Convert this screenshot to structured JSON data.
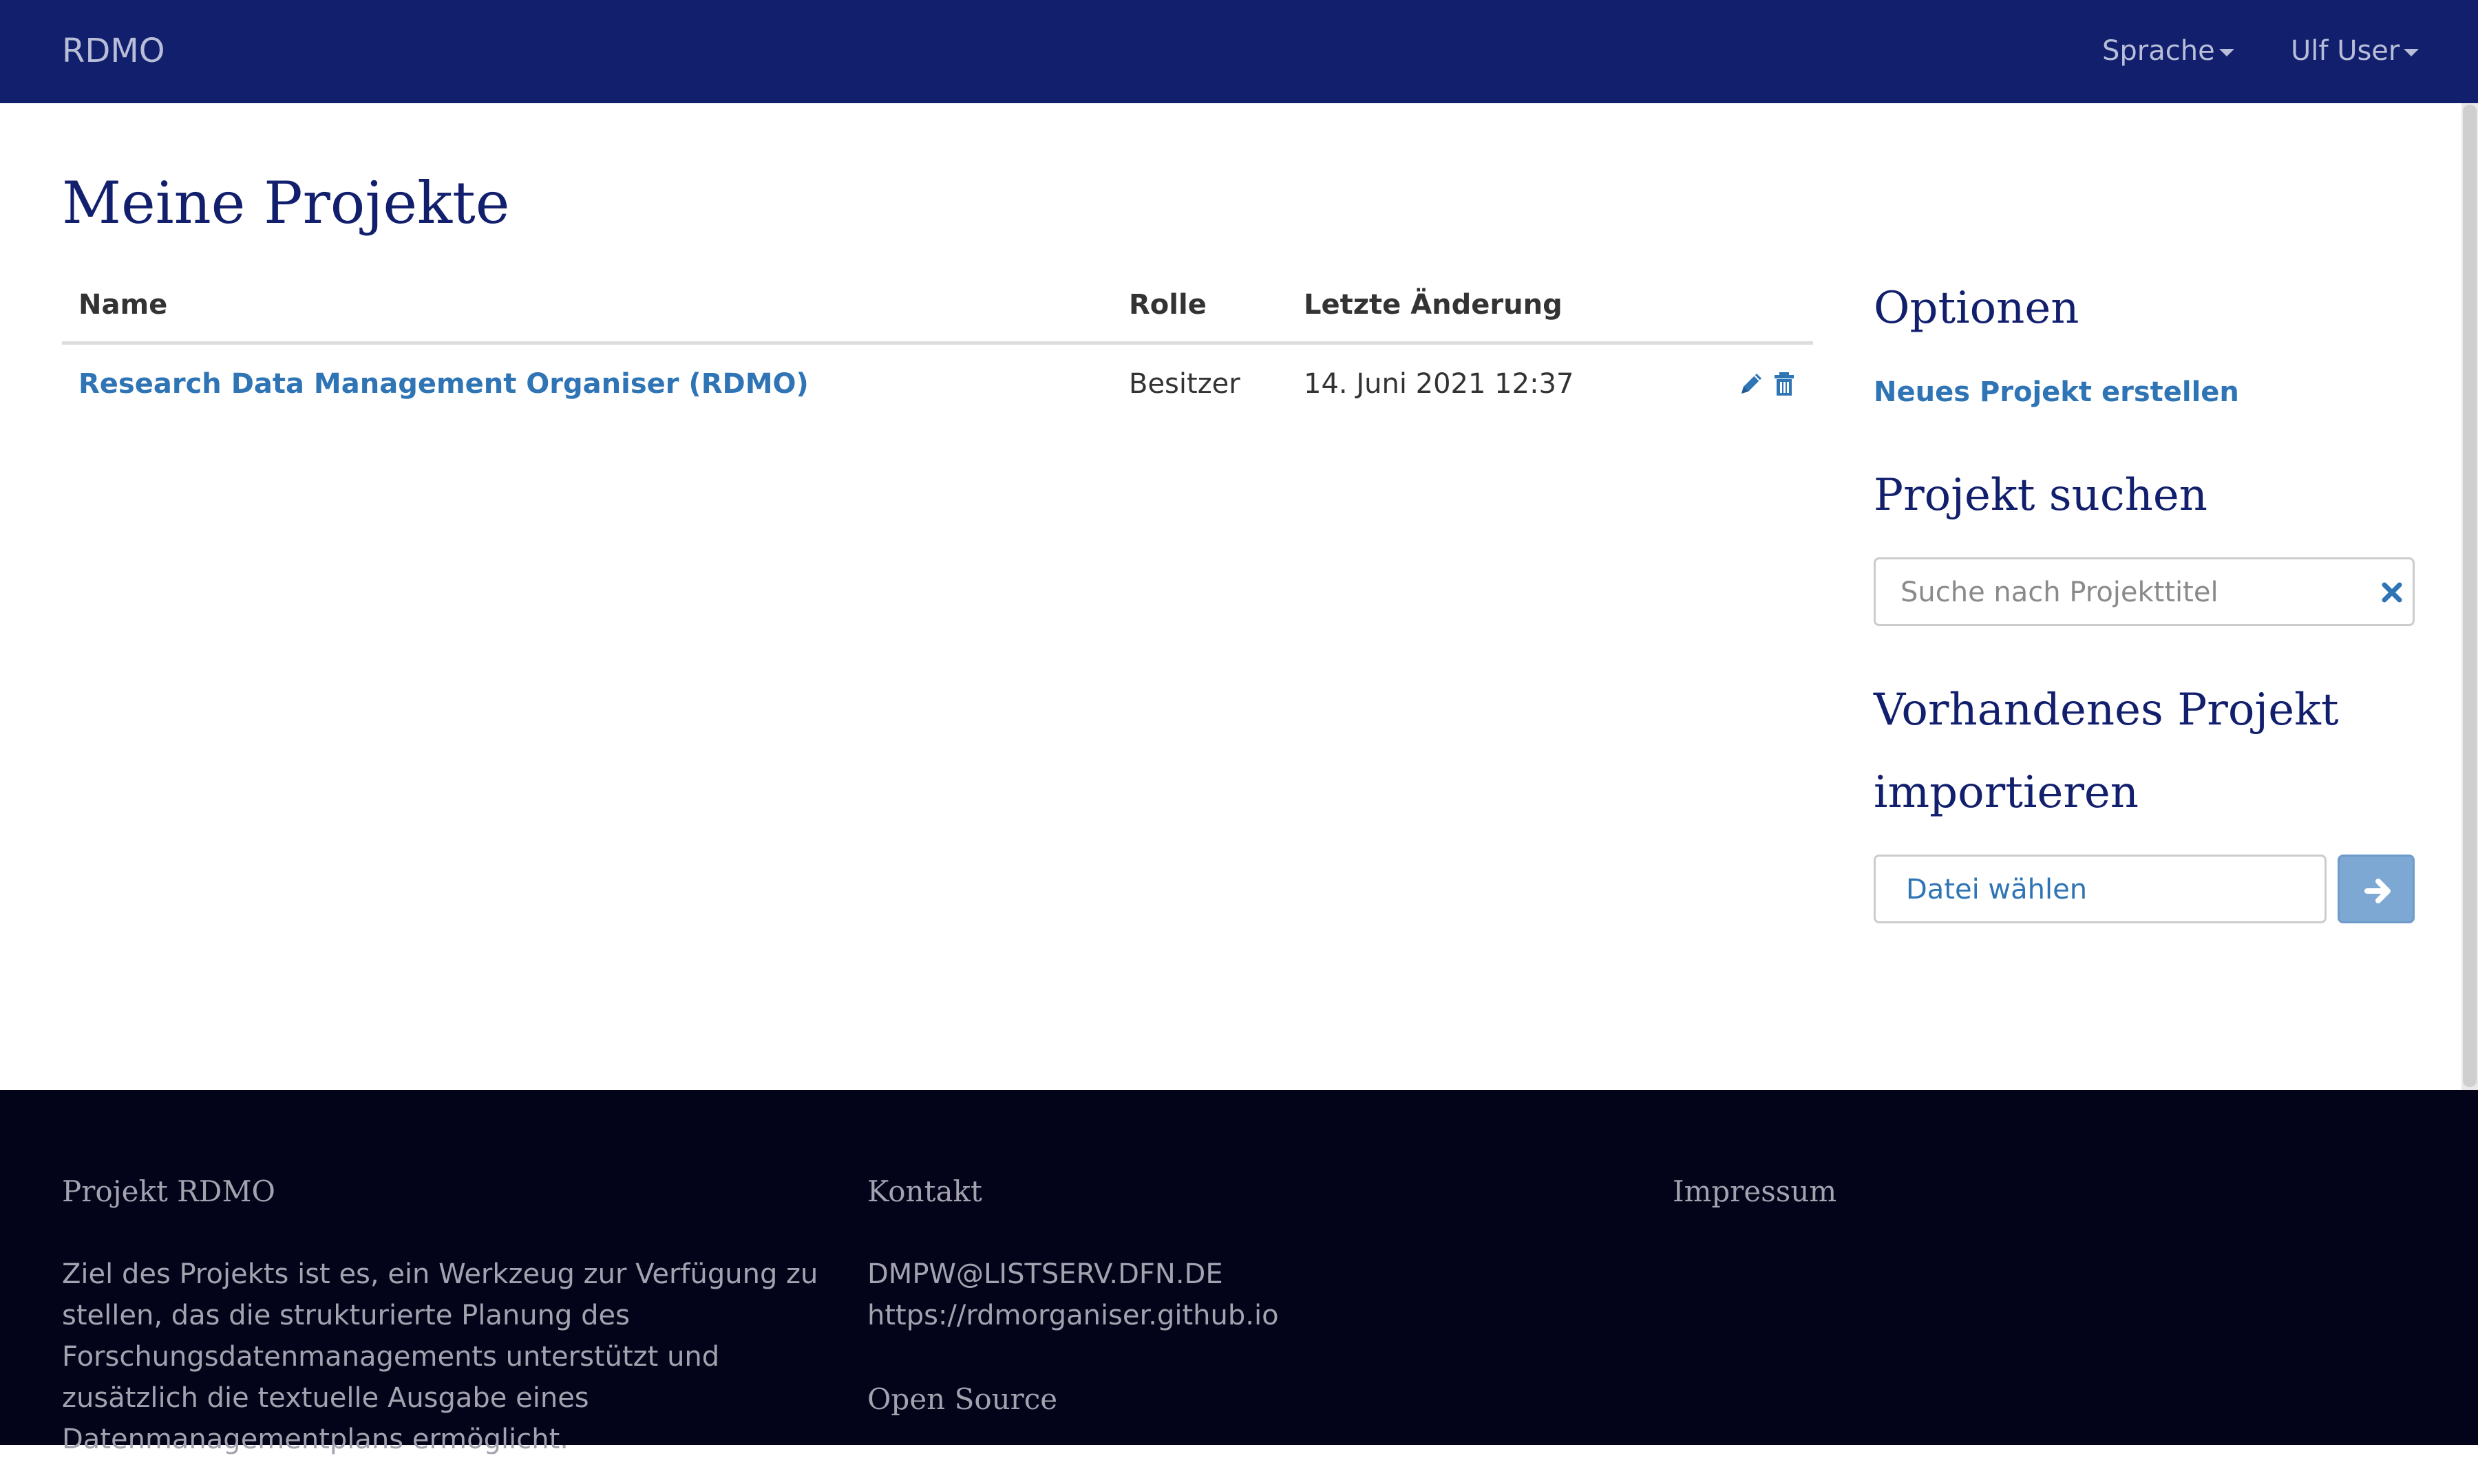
{
  "navbar": {
    "brand": "RDMO",
    "language_menu": "Sprache",
    "user_menu": "Ulf User"
  },
  "main": {
    "title": "Meine Projekte",
    "table": {
      "headers": [
        "Name",
        "Rolle",
        "Letzte Änderung"
      ],
      "rows": [
        {
          "name": "Research Data Management Organiser (RDMO)",
          "role": "Besitzer",
          "updated": "14. Juni 2021 12:37"
        }
      ]
    }
  },
  "sidebar": {
    "options_heading": "Optionen",
    "new_project_link": "Neues Projekt erstellen",
    "search_heading": "Projekt suchen",
    "search_placeholder": "Suche nach Projekttitel",
    "import_heading_line1": "Vorhandenes Projekt",
    "import_heading_line2": "importieren",
    "file_button_label": "Datei wählen"
  },
  "footer": {
    "col1_heading": "Projekt RDMO",
    "col1_text_lines": [
      "Ziel des Projekts ist es, ein Werkzeug zur Verfügung zu",
      "stellen, das die strukturierte Planung des",
      "Forschungsdatenmanagements unterstützt und",
      "zusätzlich die textuelle Ausgabe eines",
      "Datenmanagementplans ermöglicht."
    ],
    "col2_heading": "Kontakt",
    "col2_email": "DMPW@LISTSERV.DFN.DE",
    "col2_url": "https://rdmorganiser.github.io",
    "col2_open_source": "Open Source",
    "col3_heading": "Impressum"
  },
  "icons": {
    "edit": "pencil-icon",
    "delete": "trash-icon",
    "clear": "times-icon",
    "submit": "arrow-right-icon"
  },
  "colors": {
    "navbar": "#121f6d",
    "heading": "#121f6d",
    "link": "#2f74b5",
    "footer": "#03031a",
    "submit_button": "#7ea8d4"
  }
}
